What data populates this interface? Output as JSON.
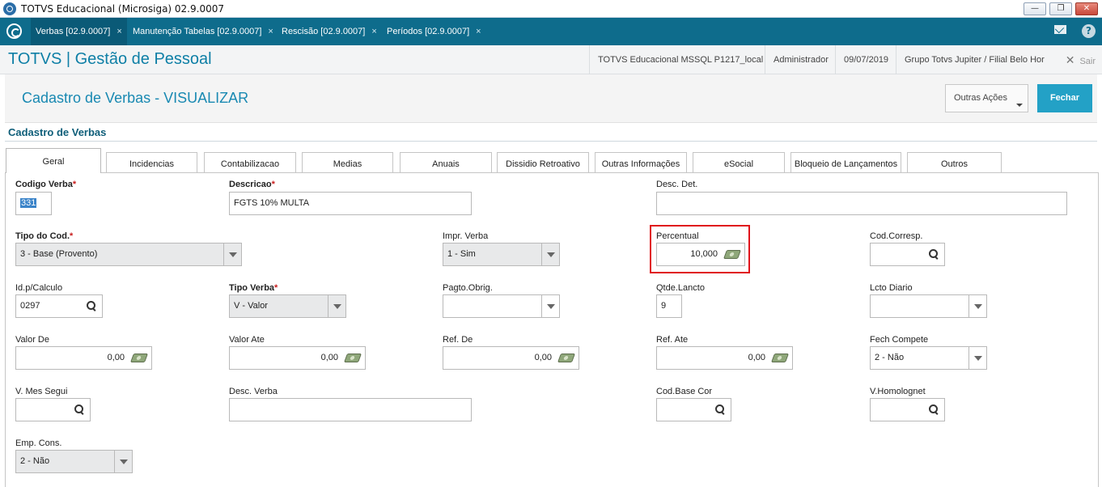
{
  "window": {
    "title": "TOTVS Educacional (Microsiga) 02.9.0007",
    "minimize_label": "—",
    "restore_label": "❐",
    "close_label": "✕"
  },
  "open_tabs": [
    {
      "label": "Verbas [02.9.0007]"
    },
    {
      "label": "Manutenção Tabelas [02.9.0007]"
    },
    {
      "label": "Rescisão [02.9.0007]"
    },
    {
      "label": "Períodos [02.9.0007]"
    }
  ],
  "tab_close_glyph": "×",
  "header": {
    "brand": "TOTVS | Gestão de Pessoal",
    "environment": "TOTVS Educacional MSSQL P1217_local",
    "user": "Administrador",
    "date": "09/07/2019",
    "branch": "Grupo Totvs Jupiter / Filial Belo Hor",
    "exit_label": "Sair",
    "help_label": "?"
  },
  "page": {
    "title": "Cadastro de Verbas - VISUALIZAR",
    "other_actions_label": "Outras Ações",
    "close_label": "Fechar",
    "section_title": "Cadastro de Verbas"
  },
  "form_tabs": [
    {
      "label": "Geral"
    },
    {
      "label": "Incidencias"
    },
    {
      "label": "Contabilizacao"
    },
    {
      "label": "Medias"
    },
    {
      "label": "Anuais"
    },
    {
      "label": "Dissidio Retroativo"
    },
    {
      "label": "Outras Informações"
    },
    {
      "label": "eSocial"
    },
    {
      "label": "Bloqueio de Lançamentos"
    },
    {
      "label": "Outros"
    }
  ],
  "required_mark": "*",
  "fields": {
    "codigo_verba": {
      "label": "Codigo Verba",
      "value": "331"
    },
    "descricao": {
      "label": "Descricao",
      "value": "FGTS 10% MULTA"
    },
    "desc_det": {
      "label": "Desc. Det.",
      "value": ""
    },
    "tipo_do_cod": {
      "label": "Tipo do Cod.",
      "value": "3 - Base (Provento)"
    },
    "impr_verba": {
      "label": "Impr. Verba",
      "value": "1 - Sim"
    },
    "percentual": {
      "label": "Percentual",
      "value": "10,000"
    },
    "cod_corresp": {
      "label": "Cod.Corresp.",
      "value": ""
    },
    "id_calculo": {
      "label": "Id.p/Calculo",
      "value": "0297"
    },
    "tipo_verba": {
      "label": "Tipo Verba",
      "value": "V - Valor"
    },
    "pagto_obrig": {
      "label": "Pagto.Obrig.",
      "value": ""
    },
    "qtde_lancto": {
      "label": "Qtde.Lancto",
      "value": "9"
    },
    "lcto_diario": {
      "label": "Lcto Diario",
      "value": ""
    },
    "valor_de": {
      "label": "Valor De",
      "value": "0,00"
    },
    "valor_ate": {
      "label": "Valor Ate",
      "value": "0,00"
    },
    "ref_de": {
      "label": "Ref. De",
      "value": "0,00"
    },
    "ref_ate": {
      "label": "Ref. Ate",
      "value": "0,00"
    },
    "fech_compete": {
      "label": "Fech Compete",
      "value": "2 - Não"
    },
    "v_mes_segui": {
      "label": "V. Mes Segui",
      "value": ""
    },
    "desc_verba": {
      "label": "Desc. Verba",
      "value": ""
    },
    "cod_base_cor": {
      "label": "Cod.Base Cor",
      "value": ""
    },
    "v_homolognet": {
      "label": "V.Homolognet",
      "value": ""
    },
    "emp_cons": {
      "label": "Emp. Cons.",
      "value": "2 - Não"
    }
  }
}
